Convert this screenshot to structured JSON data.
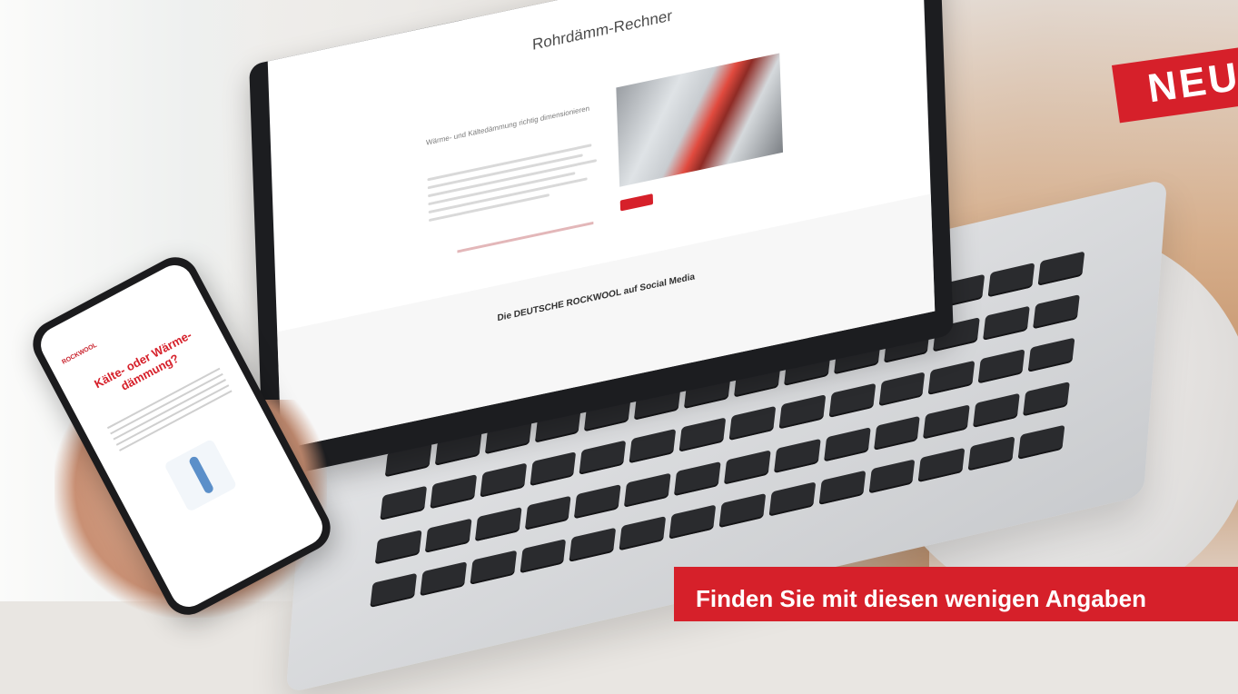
{
  "laptop_screen": {
    "title": "Rohrdämm-Rechner",
    "heading": "Wärme- und Kältedämmung richtig dimensionieren",
    "footer_heading": "Die DEUTSCHE ROCKWOOL auf Social Media"
  },
  "phone_screen": {
    "brand": "ROCKWOOL",
    "heading": "Kälte- oder Wärme-dämmung?"
  },
  "badge": {
    "text": "NEU"
  },
  "caption": {
    "text": "Finden Sie mit diesen wenigen Angaben"
  },
  "colors": {
    "brand_red": "#d6202a"
  }
}
